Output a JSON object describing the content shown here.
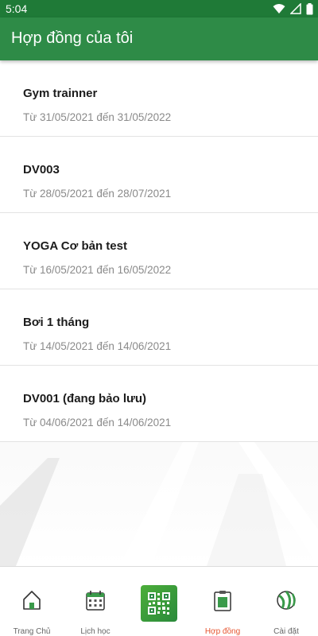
{
  "status_bar": {
    "time": "5:04"
  },
  "app_bar": {
    "title": "Hợp đồng của tôi"
  },
  "contracts": [
    {
      "name": "Gym trainner",
      "period": "Từ 31/05/2021 đến 31/05/2022"
    },
    {
      "name": "DV003",
      "period": "Từ 28/05/2021 đến 28/07/2021"
    },
    {
      "name": "YOGA Cơ bản test",
      "period": "Từ 16/05/2021 đến 16/05/2022"
    },
    {
      "name": "Bơi 1 tháng",
      "period": "Từ 14/05/2021 đến 14/06/2021"
    },
    {
      "name": "DV001 (đang bảo lưu)",
      "period": "Từ 04/06/2021 đến 14/06/2021"
    }
  ],
  "bottom_nav": {
    "items": [
      {
        "label": "Trang Chủ",
        "icon": "home-icon"
      },
      {
        "label": "Lịch học",
        "icon": "calendar-icon"
      },
      {
        "label": "",
        "icon": "qr-code-icon"
      },
      {
        "label": "Hợp đồng",
        "icon": "clipboard-icon"
      },
      {
        "label": "Cài đặt",
        "icon": "settings-ball-icon"
      }
    ],
    "active_index": 3
  },
  "colors": {
    "status_bar": "#1f7a37",
    "app_bar": "#2e8b47",
    "active_nav": "#e6542f",
    "secondary_text": "#8a8a8a"
  }
}
